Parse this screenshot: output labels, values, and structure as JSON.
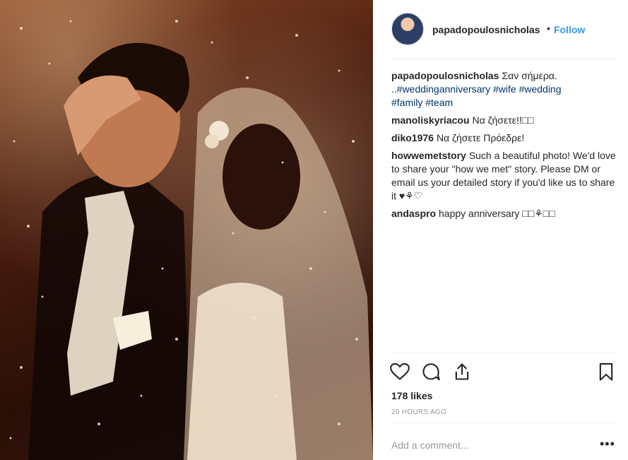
{
  "post": {
    "photo_label": "wedding-photo"
  },
  "header": {
    "username": "papadopoulosnicholas",
    "separator": "•",
    "follow_label": "Follow"
  },
  "caption": {
    "user": "papadopoulosnicholas",
    "text": "Σαν σήμερα.",
    "prefix": "..",
    "hashtags_line1": [
      "#weddinganniversary",
      "#wife",
      "#wedding"
    ],
    "hashtags_line2": [
      "#family",
      "#team"
    ]
  },
  "comments": [
    {
      "user": "manoliskyriacou",
      "text": "Να ζήσετε!!□□"
    },
    {
      "user": "diko1976",
      "text": "Να ζήσετε Πρόεδρε!"
    },
    {
      "user": "howwemetstory",
      "text": "Such a beautiful photo! We'd love to share your \"how we met\" story. Please DM or email us your detailed story if you'd like us to share it ♥⚘♡"
    },
    {
      "user": "andaspro",
      "text": "happy anniversary □□⚘□□"
    }
  ],
  "actions": {
    "like_icon": "heart-icon",
    "comment_icon": "comment-icon",
    "share_icon": "share-icon",
    "save_icon": "bookmark-icon"
  },
  "likes_text": "178 likes",
  "time_text": "20 HOURS AGO",
  "add_comment_placeholder": "Add a comment...",
  "more_label": "•••",
  "colors": {
    "link": "#3897f0",
    "hashtag": "#003569",
    "text": "#262626",
    "muted": "#999999"
  }
}
